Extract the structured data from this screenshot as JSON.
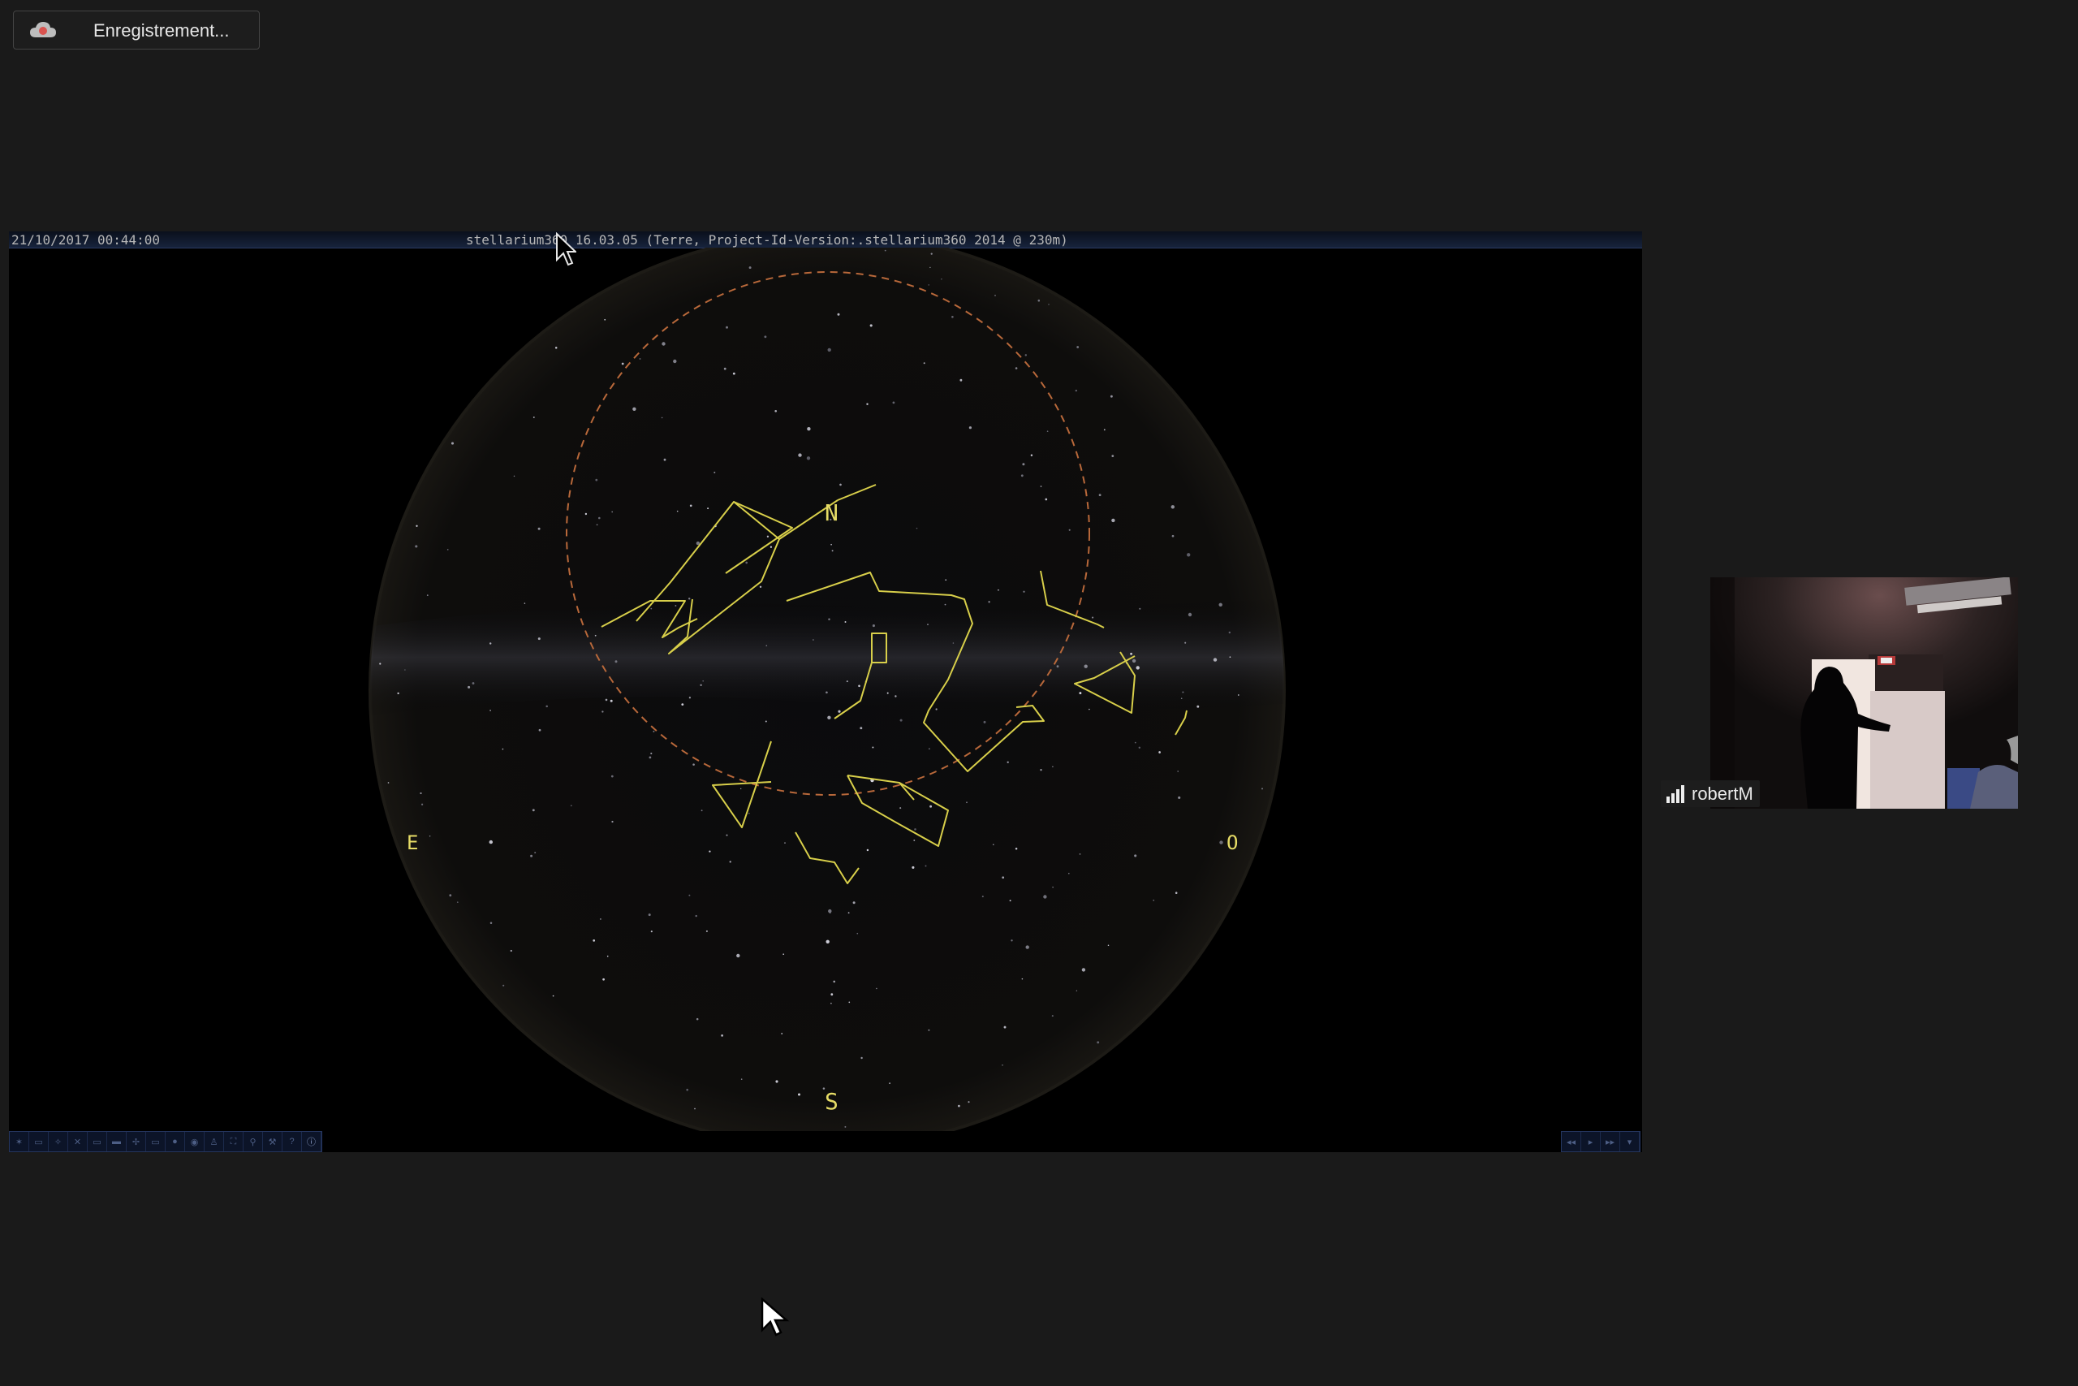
{
  "recording": {
    "label": "Enregistrement...",
    "icon": "cloud-record-icon",
    "accent": "#d9534f"
  },
  "stellarium": {
    "datetime": "21/10/2017 00:44:00",
    "app_info": "stellarium360 16.03.05 (Terre, Project-Id-Version:.stellarium360 2014 @ 230m)",
    "cardinals": {
      "north": "N",
      "south": "S",
      "east": "E",
      "west": "O"
    },
    "line_color": "#d8cf4a",
    "cardinal_color": "#e6dc66",
    "horizon_circle_color": "#b8683a"
  },
  "participant": {
    "name": "robertM",
    "signal_icon": "signal-bars-icon"
  }
}
